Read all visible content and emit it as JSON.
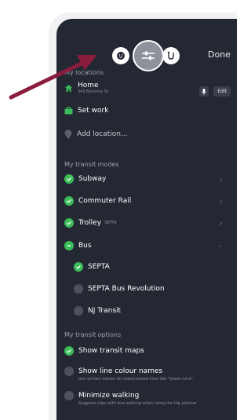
{
  "header": {
    "done_label": "Done"
  },
  "locations": {
    "section_label": "My locations",
    "home_label": "Home",
    "home_address": "343 Baronne St.",
    "edit_label": "Edit",
    "set_work_label": "Set work",
    "add_location_label": "Add location..."
  },
  "modes": {
    "section_label": "My transit modes",
    "items": [
      {
        "label": "Subway",
        "state": "checked"
      },
      {
        "label": "Commuter Rail",
        "state": "checked"
      },
      {
        "label": "Trolley",
        "note": "SEPTA",
        "state": "checked"
      },
      {
        "label": "Bus",
        "state": "partial"
      }
    ],
    "bus_agencies": [
      {
        "label": "SEPTA",
        "state": "checked"
      },
      {
        "label": "SEPTA Bus Revolution",
        "state": "unchecked"
      },
      {
        "label": "NJ Transit",
        "state": "unchecked"
      }
    ]
  },
  "options": {
    "section_label": "My transit options",
    "items": [
      {
        "label": "Show transit maps",
        "state": "checked"
      },
      {
        "label": "Show line colour names",
        "desc": "Use written names for colour-based lines like \"Green Line\"",
        "state": "unchecked"
      },
      {
        "label": "Minimize walking",
        "desc": "Suggests trips with less walking when using the trip planner",
        "state": "unchecked"
      }
    ]
  },
  "colors": {
    "screen_bg": "#242833",
    "accent_green": "#3dbd5a",
    "arrow": "#8a1c3c"
  }
}
